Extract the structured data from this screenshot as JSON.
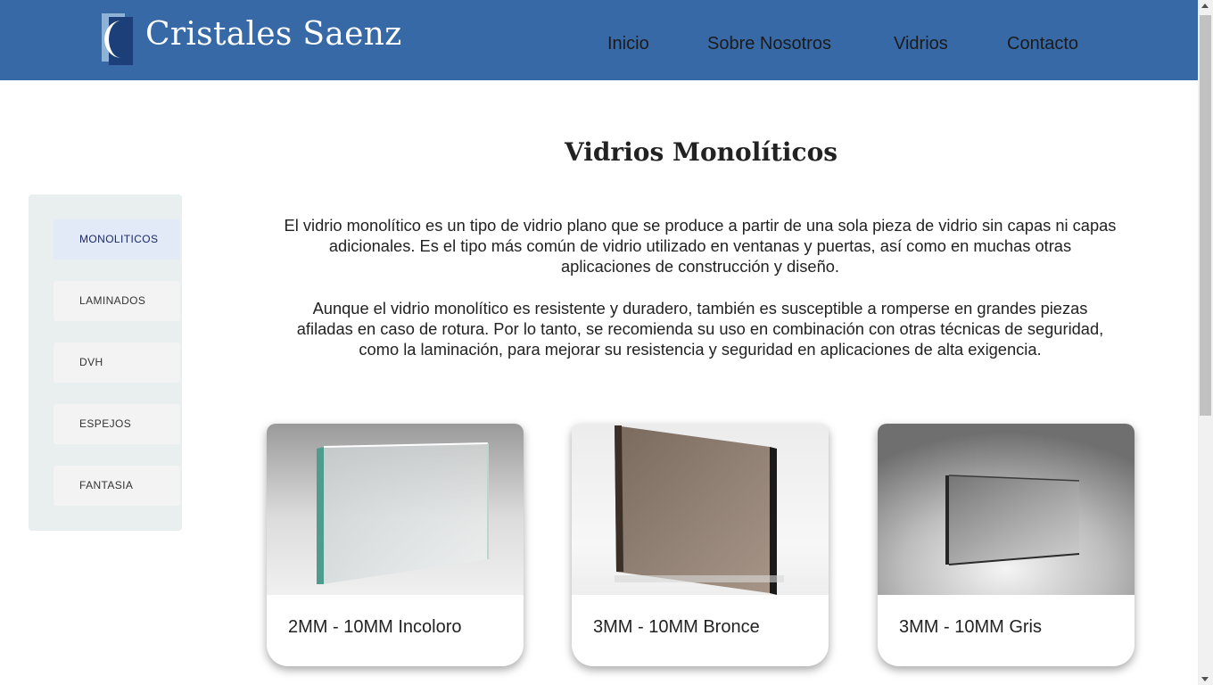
{
  "header": {
    "brand": "Cristales Saenz",
    "colors": {
      "bar": "#3769a6",
      "brand_text": "#ffffff"
    },
    "nav": [
      {
        "label": "Inicio"
      },
      {
        "label": "Sobre Nosotros"
      },
      {
        "label": "Vidrios"
      },
      {
        "label": "Contacto"
      }
    ]
  },
  "sidebar": {
    "items": [
      {
        "label": "MONOLITICOS",
        "active": true
      },
      {
        "label": "LAMINADOS",
        "active": false
      },
      {
        "label": "DVH",
        "active": false
      },
      {
        "label": "ESPEJOS",
        "active": false
      },
      {
        "label": "FANTASIA",
        "active": false
      }
    ]
  },
  "main": {
    "title": "Vidrios Monolíticos",
    "paragraphs": [
      "El vidrio monolítico es un tipo de vidrio plano que se produce a partir de una sola pieza de vidrio sin capas ni capas adicionales. Es el tipo más común de vidrio utilizado en ventanas y puertas, así como en muchas otras aplicaciones de construcción y diseño.",
      "Aunque el vidrio monolítico es resistente y duradero, también es susceptible a romperse en grandes piezas afiladas en caso de rotura. Por lo tanto, se recomienda su uso en combinación con otras técnicas de seguridad, como la laminación, para mejorar su resistencia y seguridad en aplicaciones de alta exigencia."
    ],
    "cards": [
      {
        "label": "2MM - 10MM Incoloro",
        "image": "clear-glass-panel-image"
      },
      {
        "label": "3MM - 10MM Bronce",
        "image": "bronze-glass-panel-image"
      },
      {
        "label": "3MM - 10MM Gris",
        "image": "grey-glass-panel-image"
      }
    ]
  }
}
